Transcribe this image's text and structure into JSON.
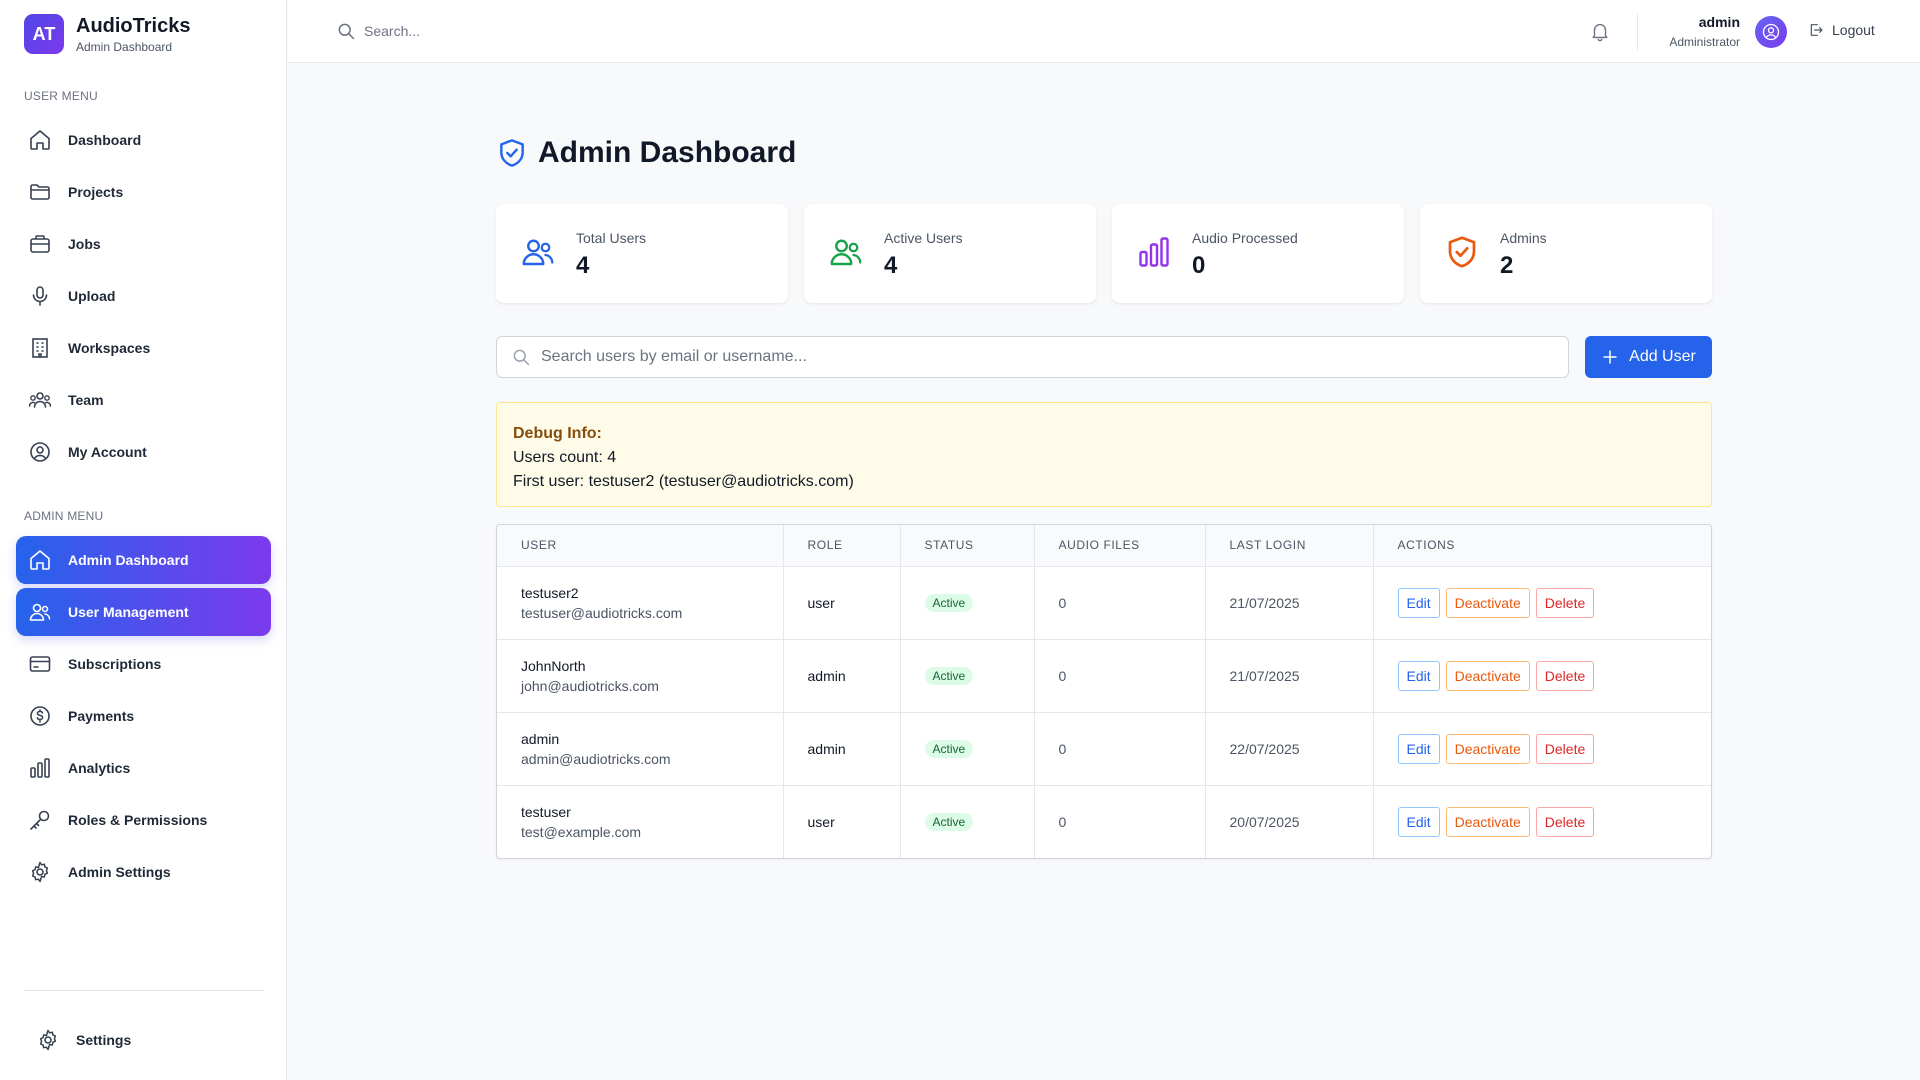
{
  "brand": {
    "logo": "AT",
    "name": "AudioTricks",
    "subtitle": "Admin Dashboard"
  },
  "sidebar": {
    "user_menu_label": "USER MENU",
    "user_items": [
      {
        "label": "Dashboard",
        "icon": "home-icon"
      },
      {
        "label": "Projects",
        "icon": "folder-icon"
      },
      {
        "label": "Jobs",
        "icon": "briefcase-icon"
      },
      {
        "label": "Upload",
        "icon": "microphone-icon"
      },
      {
        "label": "Workspaces",
        "icon": "building-icon"
      },
      {
        "label": "Team",
        "icon": "team-icon"
      },
      {
        "label": "My Account",
        "icon": "user-circle-icon"
      }
    ],
    "admin_menu_label": "ADMIN MENU",
    "admin_items": [
      {
        "label": "Admin Dashboard",
        "icon": "home-icon",
        "active": true
      },
      {
        "label": "User Management",
        "icon": "users-icon",
        "active": true
      },
      {
        "label": "Subscriptions",
        "icon": "credit-card-icon"
      },
      {
        "label": "Payments",
        "icon": "dollar-icon"
      },
      {
        "label": "Analytics",
        "icon": "bar-chart-icon"
      },
      {
        "label": "Roles & Permissions",
        "icon": "key-icon"
      },
      {
        "label": "Admin Settings",
        "icon": "gear-icon"
      }
    ],
    "settings_label": "Settings"
  },
  "header": {
    "search_placeholder": "Search...",
    "user_name": "admin",
    "user_role": "Administrator",
    "logout_label": "Logout"
  },
  "main": {
    "title": "Admin Dashboard",
    "stats": [
      {
        "label": "Total Users",
        "value": "4",
        "color": "#2563eb"
      },
      {
        "label": "Active Users",
        "value": "4",
        "color": "#16a34a"
      },
      {
        "label": "Audio Processed",
        "value": "0",
        "color": "#9333ea"
      },
      {
        "label": "Admins",
        "value": "2",
        "color": "#ea580c"
      }
    ],
    "search_placeholder": "Search users by email or username...",
    "add_user_label": "Add User",
    "debug": {
      "title": "Debug Info:",
      "line1": "Users count: 4",
      "line2": "First user: testuser2 (testuser@audiotricks.com)"
    },
    "table": {
      "columns": [
        "USER",
        "ROLE",
        "STATUS",
        "AUDIO FILES",
        "LAST LOGIN",
        "ACTIONS"
      ],
      "rows": [
        {
          "name": "testuser2",
          "email": "testuser@audiotricks.com",
          "role": "user",
          "status": "Active",
          "audio_files": "0",
          "last_login": "21/07/2025"
        },
        {
          "name": "JohnNorth",
          "email": "john@audiotricks.com",
          "role": "admin",
          "status": "Active",
          "audio_files": "0",
          "last_login": "21/07/2025"
        },
        {
          "name": "admin",
          "email": "admin@audiotricks.com",
          "role": "admin",
          "status": "Active",
          "audio_files": "0",
          "last_login": "22/07/2025"
        },
        {
          "name": "testuser",
          "email": "test@example.com",
          "role": "user",
          "status": "Active",
          "audio_files": "0",
          "last_login": "20/07/2025"
        }
      ],
      "actions": {
        "edit": "Edit",
        "deactivate": "Deactivate",
        "delete": "Delete"
      }
    }
  },
  "colors": {
    "accent": "#2563eb",
    "accent_purple": "#7c3aed",
    "active_badge_bg": "#dcfce7",
    "debug_bg": "#fefce8"
  }
}
